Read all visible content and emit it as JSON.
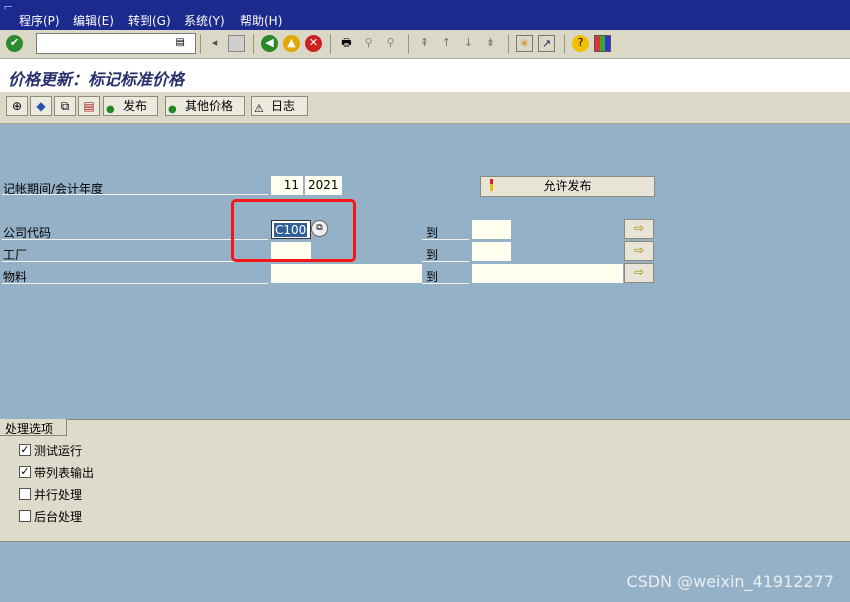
{
  "menu": [
    "程序(P)",
    "编辑(E)",
    "转到(G)",
    "系统(Y)",
    "帮助(H)"
  ],
  "menu_glyph": "⌐",
  "command_field": {
    "value": "",
    "dropdown_icon": "list-icon"
  },
  "title": "价格更新：标记标准价格",
  "app_toolbar": {
    "release": "发布",
    "other_prices": "其他价格",
    "log": "日志"
  },
  "form": {
    "period_label": "记帐期间/会计年度",
    "period": "11",
    "year": "2021",
    "allow_release_button": "允许发布",
    "company_code_label": "公司代码",
    "company_code": "C100",
    "plant_label": "工厂",
    "material_label": "物料",
    "to_label": "到",
    "arrow_glyph": "⇨"
  },
  "processing_options": {
    "group_title": "处理选项",
    "items": [
      {
        "label": "测试运行",
        "checked": true
      },
      {
        "label": "带列表输出",
        "checked": true
      },
      {
        "label": "并行处理",
        "checked": false
      },
      {
        "label": "后台处理",
        "checked": false
      }
    ]
  },
  "watermark": "CSDN @weixin_41912277",
  "colors": {
    "menubar": "#1b2a8c",
    "background": "#95b1c7",
    "highlight_box": "#f21818"
  }
}
